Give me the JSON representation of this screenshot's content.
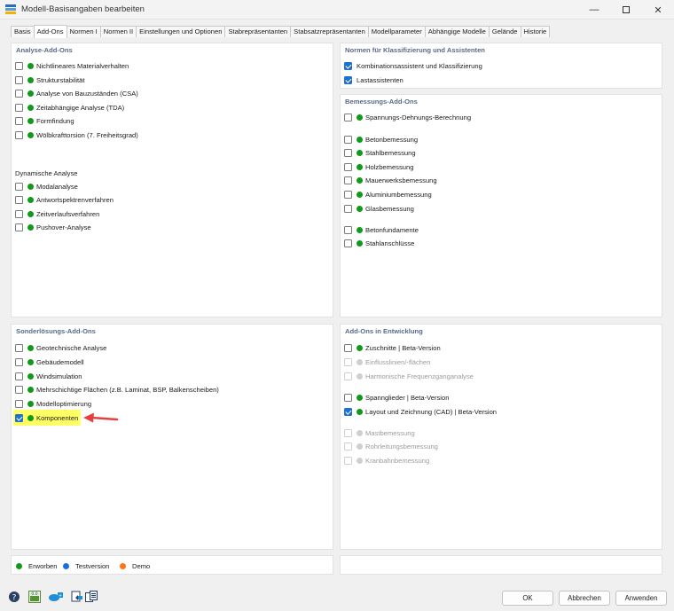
{
  "window": {
    "title": "Modell-Basisangaben bearbeiten"
  },
  "tabs": [
    "Basis",
    "Add-Ons",
    "Normen I",
    "Normen II",
    "Einstellungen und Optionen",
    "Stabrepräsentanten",
    "Stabsatzrepräsentanten",
    "Modellparameter",
    "Abhängige Modelle",
    "Gelände",
    "Historie"
  ],
  "active_tab": "Add-Ons",
  "analyse": {
    "title": "Analyse-Add-Ons",
    "items": [
      {
        "label": "Nichtlineares Materialverhalten",
        "checked": false,
        "status": "green"
      },
      {
        "label": "Strukturstabilität",
        "checked": false,
        "status": "green"
      },
      {
        "label": "Analyse von Bauzuständen (CSA)",
        "checked": false,
        "status": "green"
      },
      {
        "label": "Zeitabhängige Analyse (TDA)",
        "checked": false,
        "status": "green"
      },
      {
        "label": "Formfindung",
        "checked": false,
        "status": "green"
      },
      {
        "label": "Wölbkrafttorsion (7. Freiheitsgrad)",
        "checked": false,
        "status": "green"
      }
    ],
    "dyn_title": "Dynamische Analyse",
    "dyn_items": [
      {
        "label": "Modalanalyse",
        "checked": false,
        "status": "green"
      },
      {
        "label": "Antwortspektrenverfahren",
        "checked": false,
        "status": "green"
      },
      {
        "label": "Zeitverlaufsverfahren",
        "checked": false,
        "status": "green"
      },
      {
        "label": "Pushover-Analyse",
        "checked": false,
        "status": "green"
      }
    ]
  },
  "normen": {
    "title": "Normen für Klassifizierung und Assistenten",
    "items": [
      {
        "label": "Kombinationsassistent und Klassifizierung",
        "checked": true
      },
      {
        "label": "Lastassistenten",
        "checked": true
      }
    ]
  },
  "bemessung": {
    "title": "Bemessungs-Add-Ons",
    "group1": [
      {
        "label": "Spannungs-Dehnungs-Berechnung",
        "checked": false,
        "status": "green"
      }
    ],
    "group2": [
      {
        "label": "Betonbemessung",
        "checked": false,
        "status": "green"
      },
      {
        "label": "Stahlbemessung",
        "checked": false,
        "status": "green"
      },
      {
        "label": "Holzbemessung",
        "checked": false,
        "status": "green"
      },
      {
        "label": "Mauerwerksbemessung",
        "checked": false,
        "status": "green"
      },
      {
        "label": "Aluminiumbemessung",
        "checked": false,
        "status": "green"
      },
      {
        "label": "Glasbemessung",
        "checked": false,
        "status": "green"
      }
    ],
    "group3": [
      {
        "label": "Betonfundamente",
        "checked": false,
        "status": "green"
      },
      {
        "label": "Stahlanschlüsse",
        "checked": false,
        "status": "green"
      }
    ]
  },
  "sonder": {
    "title": "Sonderlösungs-Add-Ons",
    "items": [
      {
        "label": "Geotechnische Analyse",
        "checked": false,
        "status": "green"
      },
      {
        "label": "Gebäudemodell",
        "checked": false,
        "status": "green"
      },
      {
        "label": "Windsimulation",
        "checked": false,
        "status": "green"
      },
      {
        "label": "Mehrschichtige Flächen (z.B. Laminat, BSP, Balkenscheiben)",
        "checked": false,
        "status": "green"
      },
      {
        "label": "Modelloptimierung",
        "checked": false,
        "status": "green"
      },
      {
        "label": "Komponenten",
        "checked": true,
        "status": "green"
      }
    ]
  },
  "entwicklung": {
    "title": "Add-Ons in Entwicklung",
    "group1": [
      {
        "label": "Zuschnitte | Beta-Version",
        "checked": false,
        "status": "green",
        "disabled": false
      },
      {
        "label": "Einflusslinien/-flächen",
        "checked": false,
        "status": "grey",
        "disabled": true
      },
      {
        "label": "Harmonische Frequenzganganalyse",
        "checked": false,
        "status": "grey",
        "disabled": true
      }
    ],
    "group2": [
      {
        "label": "Spannglieder | Beta-Version",
        "checked": false,
        "status": "green",
        "disabled": false
      },
      {
        "label": "Layout und Zeichnung (CAD) | Beta-Version",
        "checked": true,
        "status": "green",
        "disabled": false
      }
    ],
    "group3": [
      {
        "label": "Mastbemessung",
        "checked": false,
        "status": "grey",
        "disabled": true
      },
      {
        "label": "Rohrleitungsbemessung",
        "checked": false,
        "status": "grey",
        "disabled": true
      },
      {
        "label": "Kranbahnbemessung",
        "checked": false,
        "status": "grey",
        "disabled": true
      }
    ]
  },
  "legend": [
    {
      "label": "Erworben",
      "color": "#119a1a"
    },
    {
      "label": "Testversion",
      "color": "#1a6fe0"
    },
    {
      "label": "Demo",
      "color": "#ff7417"
    }
  ],
  "buttons": {
    "ok": "OK",
    "cancel": "Abbrechen",
    "apply": "Anwenden"
  },
  "colors": {
    "accent": "#1f6fd0",
    "header": "#586a8a",
    "highlight": "#ffff66",
    "arrow": "#e5403f"
  }
}
